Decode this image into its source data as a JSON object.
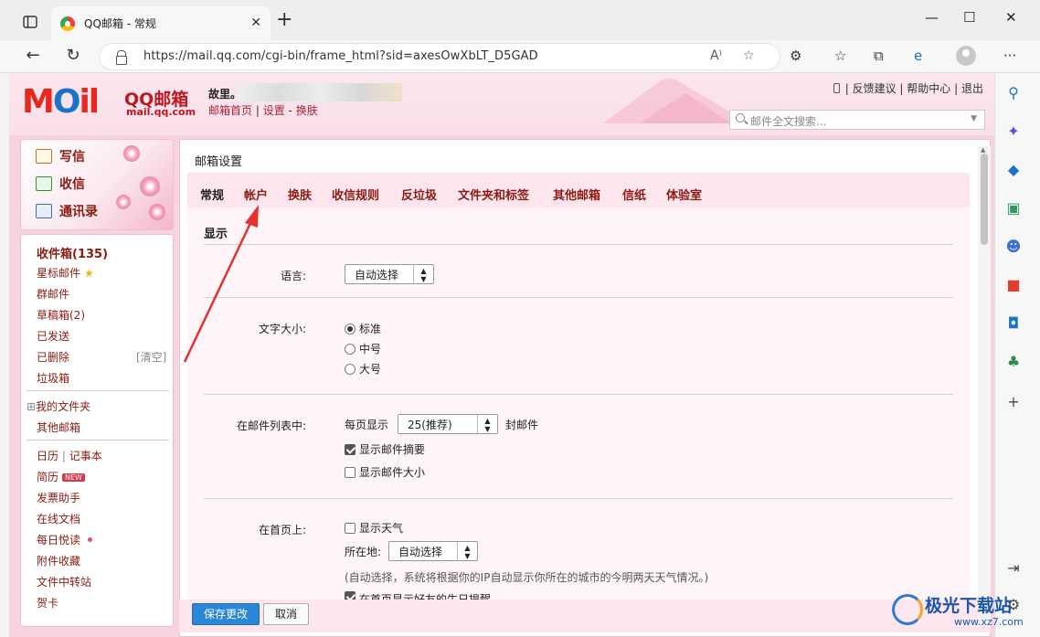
{
  "browser": {
    "tab_title": "QQ邮箱 - 常规",
    "url": "https://mail.qq.com/cgi-bin/frame_html?sid=axesOwXbLT_D5GAD",
    "window_controls": {
      "minimize": "—",
      "maximize": "☐",
      "close": "✕"
    }
  },
  "header": {
    "logo_word": "MOil",
    "logo_qq": "QQ邮箱",
    "logo_domain": "mail.qq.com",
    "user_name": "故里。",
    "user_links": [
      "邮箱首页",
      "设置",
      "换肤"
    ],
    "top_links": [
      "反馈建议",
      "帮助中心",
      "退出"
    ],
    "search_placeholder": "邮件全文搜索..."
  },
  "left": {
    "compose": "写信",
    "inbox_btn": "收信",
    "contacts": "通讯录",
    "folders": {
      "inbox": "收件箱(135)",
      "starred": "星标邮件",
      "group": "群邮件",
      "drafts": "草稿箱(2)",
      "sent": "已发送",
      "deleted": "已删除",
      "clear": "[清空]",
      "spam": "垃圾箱",
      "my_folders": "我的文件夹",
      "other_mailbox": "其他邮箱",
      "calendar": "日历",
      "notes": "记事本",
      "resume": "简历",
      "new_badge": "NEW",
      "invoice": "发票助手",
      "docs": "在线文档",
      "daily": "每日悦读",
      "attachments": "附件收藏",
      "transfer": "文件中转站",
      "cards": "贺卡"
    }
  },
  "settings": {
    "title": "邮箱设置",
    "tabs": [
      "常规",
      "帐户",
      "换肤",
      "收信规则",
      "反垃圾",
      "文件夹和标签",
      "其他邮箱",
      "信纸",
      "体验室"
    ],
    "section_display": "显示",
    "language_label": "语言:",
    "language_value": "自动选择",
    "font_size_label": "文字大小:",
    "font_options": [
      "标准",
      "中号",
      "大号"
    ],
    "list_label": "在邮件列表中:",
    "per_page_prefix": "每页显示",
    "per_page_value": "25(推荐)",
    "per_page_suffix": "封邮件",
    "show_summary": "显示邮件摘要",
    "show_size": "显示邮件大小",
    "home_label": "在首页上:",
    "show_weather": "显示天气",
    "location_label": "所在地:",
    "location_value": "自动选择",
    "weather_note": "(自动选择，系统将根据你的IP自动显示你所在的城市的今明两天天气情况。)",
    "birthday_note": "在首页显示好友的生日提醒",
    "save_button": "保存更改",
    "cancel_button": "取消"
  },
  "watermark": {
    "text": "极光下载站",
    "sub": "www.xz7.com"
  }
}
